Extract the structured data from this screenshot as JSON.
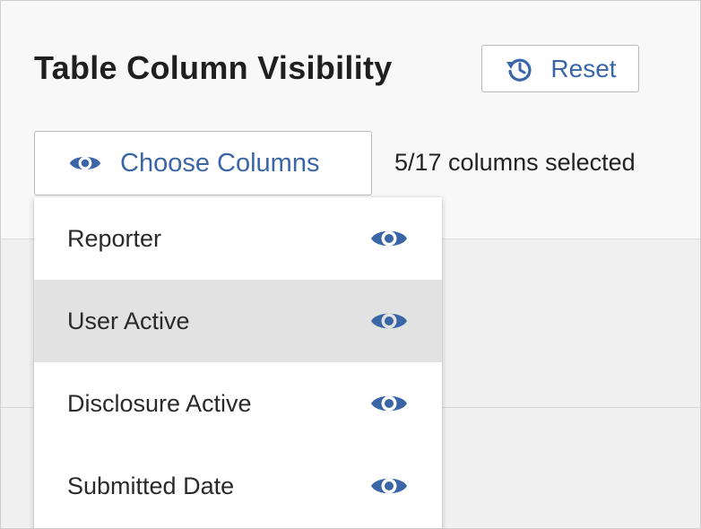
{
  "header": {
    "title": "Table Column Visibility",
    "reset_label": "Reset"
  },
  "toolbar": {
    "choose_label": "Choose Columns",
    "selected_count": "5/17 columns selected"
  },
  "menu": {
    "items": [
      {
        "label": "Reporter",
        "visible": true,
        "highlighted": false
      },
      {
        "label": "User Active",
        "visible": true,
        "highlighted": true
      },
      {
        "label": "Disclosure Active",
        "visible": true,
        "highlighted": false
      },
      {
        "label": "Submitted Date",
        "visible": true,
        "highlighted": false
      }
    ]
  },
  "colors": {
    "accent": "#3a66a7",
    "title_text": "#1f1f1f",
    "highlight_row": "#e2e2e2",
    "panel_background": "#f8f8f8"
  },
  "icons": {
    "reset": "reset-history-icon",
    "choose": "eye-icon",
    "menu_item": "eye-icon"
  }
}
